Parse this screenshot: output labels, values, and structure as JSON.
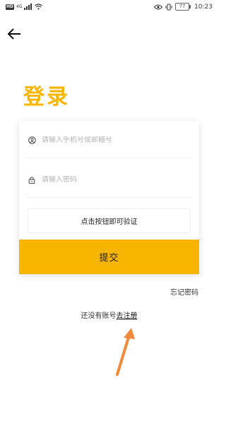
{
  "status_bar": {
    "network_badge": "HD",
    "signal": "4G",
    "battery": "77",
    "time": "10:23"
  },
  "header": {
    "back_icon": "arrow-left-icon"
  },
  "page": {
    "title": "登录"
  },
  "form": {
    "account_placeholder": "请输入手机号或邮箱号",
    "account_icon": "user-circle-icon",
    "password_placeholder": "请输入密码",
    "password_icon": "lock-icon",
    "verify_label": "点击按钮即可验证",
    "submit_label": "提交"
  },
  "links": {
    "forgot_password": "忘记密码",
    "no_account_text": "还没有账号",
    "register_label": "去注册"
  },
  "colors": {
    "accent": "#f7b500",
    "annotation_arrow": "#f08a3a"
  }
}
